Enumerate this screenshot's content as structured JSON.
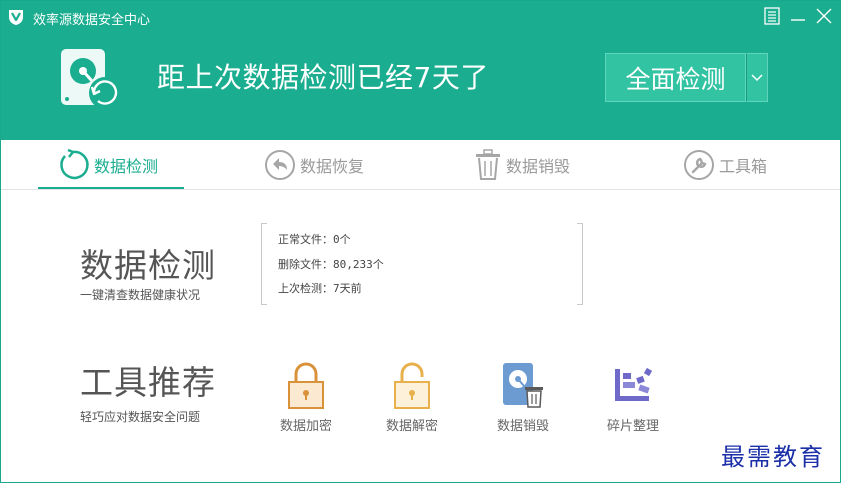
{
  "titlebar": {
    "title": "效率源数据安全中心",
    "logo_icon": "shield-v-icon",
    "menu_icon": "menu-icon",
    "minimize_icon": "minimize-icon",
    "close_icon": "close-icon"
  },
  "banner": {
    "icon": "disk-refresh-icon",
    "headline": "距上次数据检测已经7天了",
    "scan_button_label": "全面检测",
    "dropdown_icon": "chevron-down-icon"
  },
  "tabs": [
    {
      "label": "数据检测",
      "icon": "refresh-icon",
      "active": true
    },
    {
      "label": "数据恢复",
      "icon": "undo-icon",
      "active": false
    },
    {
      "label": "数据销毁",
      "icon": "trash-icon",
      "active": false
    },
    {
      "label": "工具箱",
      "icon": "wrench-icon",
      "active": false
    }
  ],
  "detect": {
    "title": "数据检测",
    "subtitle": "一键清查数据健康状况",
    "stats": [
      "正常文件：0个",
      "删除文件：80,233个",
      "上次检测：7天前"
    ]
  },
  "tools": {
    "title": "工具推荐",
    "subtitle": "轻巧应对数据安全问题",
    "items": [
      {
        "label": "数据加密",
        "icon": "lock-closed-icon"
      },
      {
        "label": "数据解密",
        "icon": "lock-open-icon"
      },
      {
        "label": "数据销毁",
        "icon": "disk-trash-icon"
      },
      {
        "label": "碎片整理",
        "icon": "defrag-icon"
      }
    ]
  },
  "watermark": "最需教育",
  "colors": {
    "brand": "#1aad8f",
    "button": "#32c3a2",
    "lock_orange": "#d9913a",
    "defrag_purple": "#6f6ac9"
  }
}
